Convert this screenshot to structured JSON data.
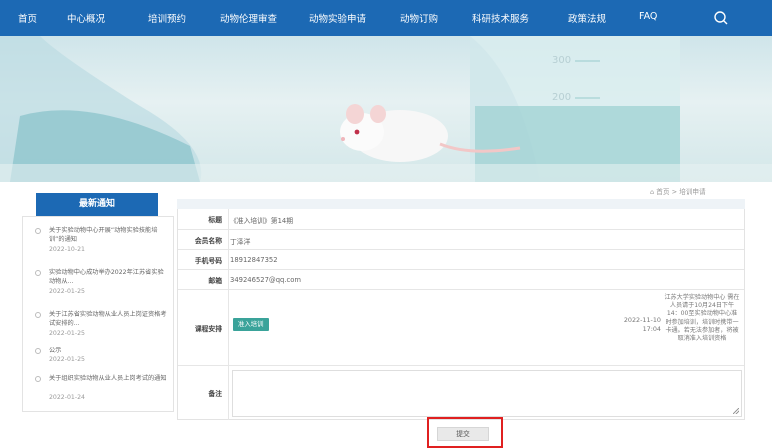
{
  "nav": {
    "items": [
      "首页",
      "中心概况",
      "培训预约",
      "动物伦理审查",
      "动物实验申请",
      "动物订购",
      "科研技术服务",
      "政策法规",
      "FAQ"
    ],
    "search_icon": "search-icon"
  },
  "banner": {
    "beaker_marks": [
      "300",
      "200"
    ]
  },
  "sidebar": {
    "title": "最新通知",
    "news": [
      {
        "title": "关于实验动物中心开展“动物实验技能培训”的通知",
        "date": "2022-10-21"
      },
      {
        "title": "实验动物中心成功举办2022年江苏省实验动物从...",
        "date": "2022-01-25"
      },
      {
        "title": "关于江苏省实验动物从业人员上岗证资格考试安排的...",
        "date": "2022-01-25"
      },
      {
        "title": "公示",
        "date": "2022-01-25"
      },
      {
        "title": "关于组织实验动物从业人员上岗考试的通知",
        "date": "2022-01-24"
      }
    ]
  },
  "breadcrumb": {
    "home": "首页",
    "separator": ">",
    "current": "培训申请"
  },
  "form": {
    "title_label": "标题",
    "title_value": "《准入培训》第14期",
    "member_label": "会员名称",
    "member_value": "丁泽洋",
    "phone_label": "手机号码",
    "phone_value": "18912847352",
    "email_label": "邮箱",
    "email_value": "349246527@qq.com",
    "course_label": "课程安排",
    "course_button": "准入培训",
    "course_date": "2022-11-10",
    "course_time": "17:04",
    "course_note": "江苏大学实验动物中心 需在人员请于10月24日下午14：00至实验动物中心准时参加培训，培训时携带一卡通。若无法参加者，将被取消准入培训资格",
    "remark_label": "备注",
    "remark_value": ""
  },
  "submit_label": "提交"
}
